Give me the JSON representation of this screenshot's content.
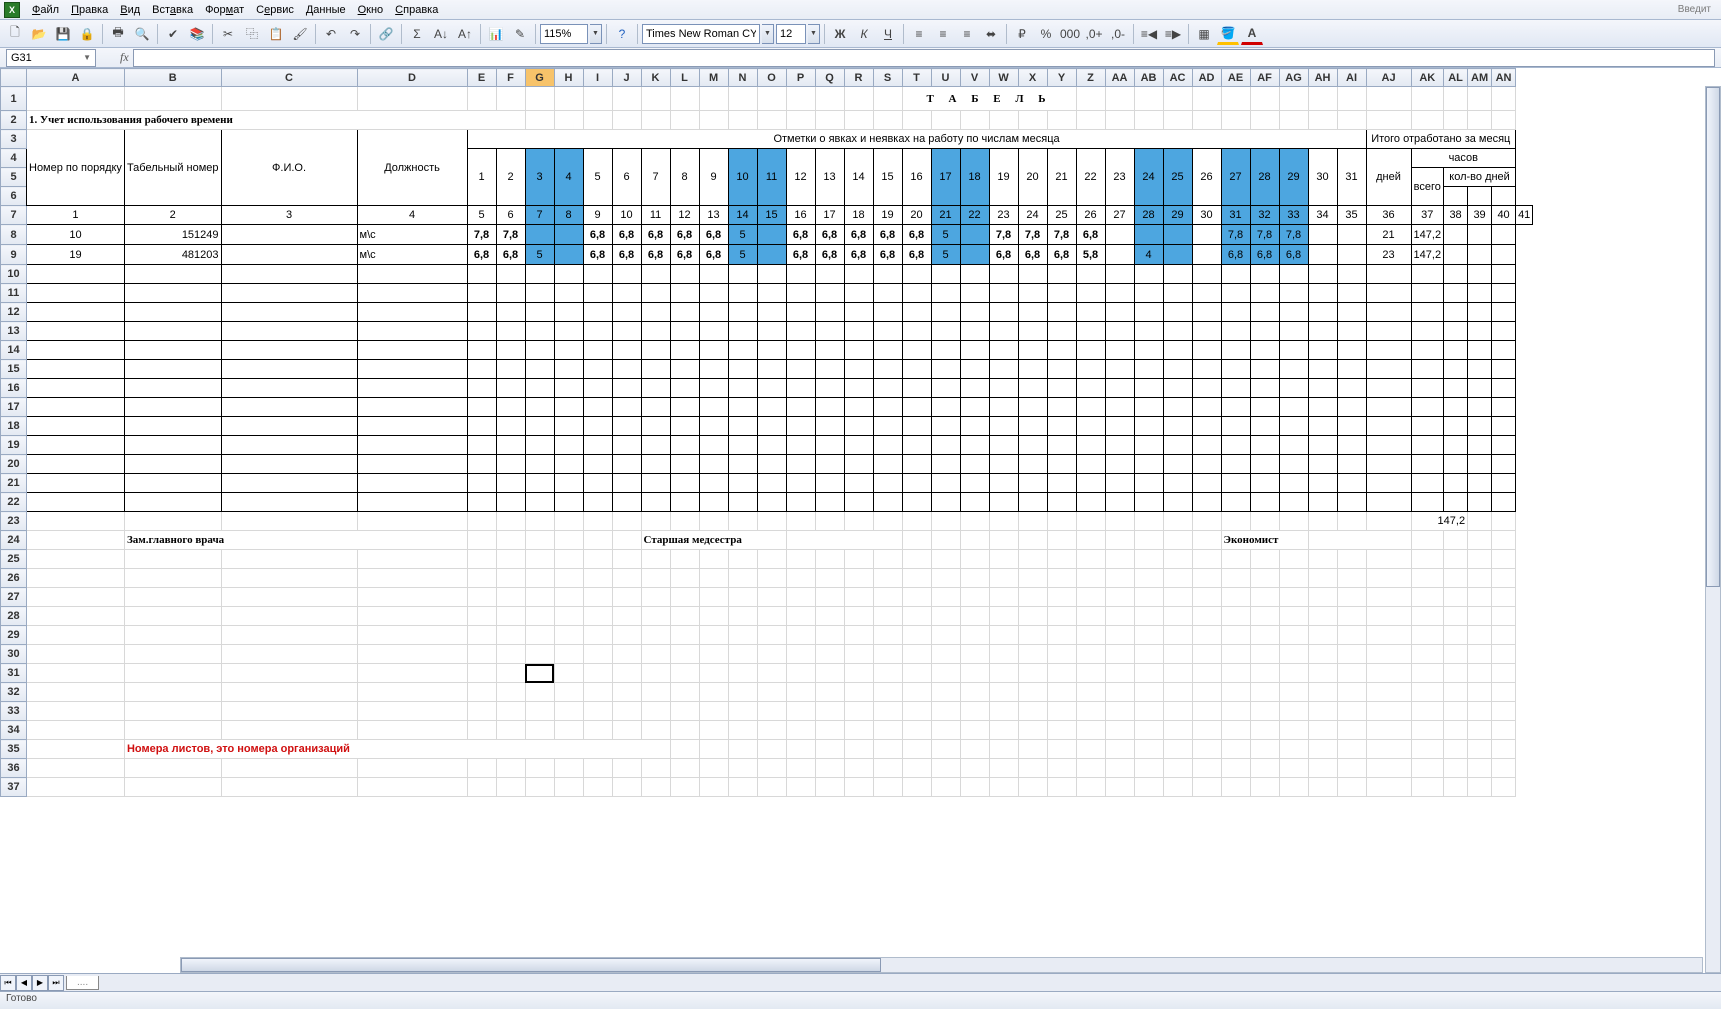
{
  "menubar": {
    "items": [
      "Файл",
      "Правка",
      "Вид",
      "Вставка",
      "Формат",
      "Сервис",
      "Данные",
      "Окно",
      "Справка"
    ],
    "login_hint": "Введит"
  },
  "toolbar": {
    "font": "Times New Roman CYR",
    "size": "12",
    "zoom": "115%"
  },
  "formula": {
    "cellref": "G31"
  },
  "title_big": "Т А Б Е Л Ь",
  "section_title": "1. Учет использования рабочего времени",
  "headers": {
    "orderNo": "Номер по порядку",
    "tabNo": "Табельный номер",
    "fio": "Ф.И.О.",
    "position": "Должность",
    "marks": "Отметки о явках и неявках на работу по числам месяца",
    "totalMonth": "Итого отработано за месяц",
    "hours": "часов",
    "daysCount": "кол-во дней",
    "days": "дней",
    "total": "всего"
  },
  "dayNumbers": [
    "1",
    "2",
    "3",
    "4",
    "5",
    "6",
    "7",
    "8",
    "9",
    "10",
    "11",
    "12",
    "13",
    "14",
    "15",
    "16",
    "17",
    "18",
    "19",
    "20",
    "21",
    "22",
    "23",
    "24",
    "25",
    "26",
    "27",
    "28",
    "29",
    "30",
    "31"
  ],
  "headerRowNums": [
    "1",
    "2",
    "3",
    "4",
    "5",
    "6",
    "7",
    "8",
    "9",
    "10",
    "11",
    "12",
    "13",
    "14",
    "15",
    "16",
    "17",
    "18",
    "19",
    "20",
    "21",
    "22",
    "23",
    "24",
    "25",
    "26",
    "27",
    "28",
    "29",
    "30",
    "31",
    "32",
    "33",
    "34",
    "35",
    "36",
    "37",
    "38",
    "39",
    "40",
    "41"
  ],
  "weekendCols": [
    3,
    4,
    10,
    11,
    17,
    18,
    24,
    25,
    27,
    28,
    29
  ],
  "rows": [
    {
      "no": "10",
      "tab": "151249",
      "fio": "",
      "pos": "м\\с",
      "d": [
        "7,8",
        "7,8",
        "",
        "",
        "6,8",
        "6,8",
        "6,8",
        "6,8",
        "6,8",
        "5",
        "",
        "6,8",
        "6,8",
        "6,8",
        "6,8",
        "6,8",
        "5",
        "",
        "7,8",
        "7,8",
        "7,8",
        "6,8",
        "",
        "",
        "",
        "",
        "7,8",
        "7,8",
        "7,8",
        "",
        ""
      ],
      "days": "21",
      "total": "147,2"
    },
    {
      "no": "19",
      "tab": "481203",
      "fio": "",
      "pos": "м\\с",
      "d": [
        "6,8",
        "6,8",
        "5",
        "",
        "6,8",
        "6,8",
        "6,8",
        "6,8",
        "6,8",
        "5",
        "",
        "6,8",
        "6,8",
        "6,8",
        "6,8",
        "6,8",
        "5",
        "",
        "6,8",
        "6,8",
        "6,8",
        "5,8",
        "",
        "4",
        "",
        "",
        "6,8",
        "6,8",
        "6,8",
        "",
        ""
      ],
      "days": "23",
      "total": "147,2"
    }
  ],
  "bottomTotal": "147,2",
  "signatures": {
    "s1": "Зам.главного врача",
    "s2": "Старшая  медсестра",
    "s3": "Экономист"
  },
  "red_note": "Номера листов, это номера организаций",
  "status": "Готово",
  "cols": [
    "A",
    "B",
    "C",
    "D",
    "E",
    "F",
    "G",
    "H",
    "I",
    "J",
    "K",
    "L",
    "M",
    "N",
    "O",
    "P",
    "Q",
    "R",
    "S",
    "T",
    "U",
    "V",
    "W",
    "X",
    "Y",
    "Z",
    "AA",
    "AB",
    "AC",
    "AD",
    "AE",
    "AF",
    "AG",
    "AH",
    "AI",
    "AJ",
    "AK",
    "AL",
    "AM",
    "AN"
  ]
}
